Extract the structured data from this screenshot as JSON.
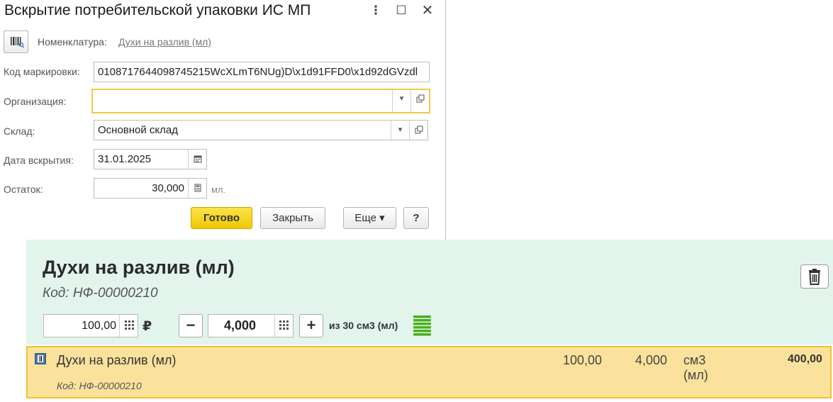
{
  "dialog": {
    "title": "Вскрытие потребительской упаковки ИС МП",
    "menu_glyph": "⋮",
    "maximize_glyph": "☐",
    "close_glyph": "✕",
    "nomenclature_label": "Номенклатура:",
    "nomenclature_value": "Духи на разлив (мл)",
    "fields": {
      "marking_code": {
        "label": "Код маркировки:",
        "value": "010871764409874521​5WcXLmT6NUg)D\\x1d91FFD0\\x1d92dGVzdl"
      },
      "organization": {
        "label": "Организация:",
        "value": ""
      },
      "warehouse": {
        "label": "Склад:",
        "value": "Основной склад"
      },
      "open_date": {
        "label": "Дата вскрытия:",
        "value": "31.01.2025"
      },
      "remainder": {
        "label": "Остаток:",
        "value": "30,000",
        "units": "мл."
      }
    },
    "buttons": {
      "ok": "Готово",
      "close": "Закрыть",
      "more": "Еще ▾",
      "help": "?"
    }
  },
  "product_panel": {
    "title": "Духи на разлив (мл)",
    "code": "Код: НФ-00000210",
    "price": "100,00",
    "currency": "₽",
    "minus": "−",
    "quantity": "4,000",
    "plus": "+",
    "of_text": "из 30 см3 (мл)"
  },
  "selected_row": {
    "name": "Духи на разлив (мл)",
    "code": "Код: НФ-00000210",
    "price": "100,00",
    "quantity": "4,000",
    "unit": "см3 (мл)",
    "sum": "400,00"
  },
  "colors": {
    "accent_yellow": "#f0c900",
    "panel_green": "#e3f4ed",
    "row_highlight": "#fbe29c",
    "stack_green": "#4caf1e"
  }
}
